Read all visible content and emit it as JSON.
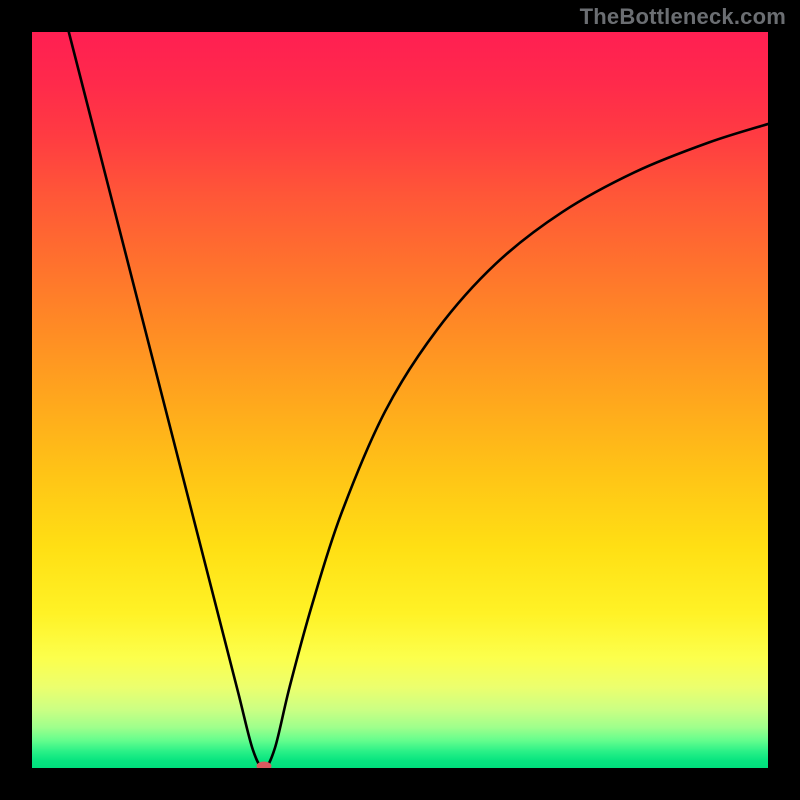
{
  "watermark": "TheBottleneck.com",
  "chart_data": {
    "type": "line",
    "title": "",
    "xlabel": "",
    "ylabel": "",
    "xlim": [
      0,
      100
    ],
    "ylim": [
      0,
      100
    ],
    "series": [
      {
        "name": "curve",
        "x": [
          5,
          10,
          15,
          20,
          25,
          28,
          30,
          31.5,
          33,
          35,
          38,
          42,
          48,
          55,
          63,
          72,
          82,
          92,
          100
        ],
        "values": [
          100,
          80.5,
          61,
          41.5,
          22,
          10.3,
          2.5,
          0,
          2.7,
          11,
          22,
          34.5,
          48.5,
          59.5,
          68.5,
          75.5,
          81,
          85,
          87.5
        ]
      }
    ],
    "marker": {
      "x": 31.5,
      "y": 0
    },
    "gradient_stops": [
      {
        "offset": 0.0,
        "color": "#ff1f52"
      },
      {
        "offset": 0.07,
        "color": "#ff2a4b"
      },
      {
        "offset": 0.14,
        "color": "#ff3b42"
      },
      {
        "offset": 0.22,
        "color": "#ff5638"
      },
      {
        "offset": 0.3,
        "color": "#ff6d2f"
      },
      {
        "offset": 0.4,
        "color": "#ff8a25"
      },
      {
        "offset": 0.5,
        "color": "#ffa71d"
      },
      {
        "offset": 0.6,
        "color": "#ffc416"
      },
      {
        "offset": 0.7,
        "color": "#ffdf14"
      },
      {
        "offset": 0.79,
        "color": "#fff226"
      },
      {
        "offset": 0.85,
        "color": "#fcff4c"
      },
      {
        "offset": 0.89,
        "color": "#ecff6e"
      },
      {
        "offset": 0.92,
        "color": "#ccff83"
      },
      {
        "offset": 0.945,
        "color": "#9eff8c"
      },
      {
        "offset": 0.963,
        "color": "#63fd8d"
      },
      {
        "offset": 0.978,
        "color": "#28f087"
      },
      {
        "offset": 0.99,
        "color": "#07e47f"
      },
      {
        "offset": 1.0,
        "color": "#00de7c"
      }
    ]
  }
}
